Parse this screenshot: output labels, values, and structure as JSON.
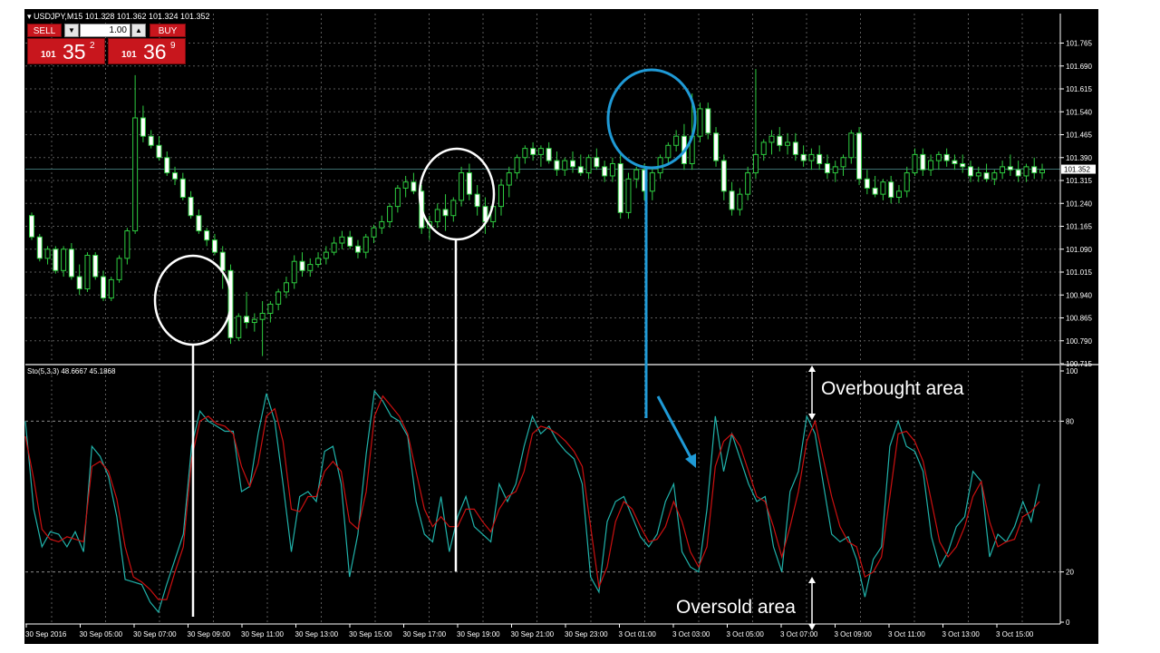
{
  "chart_data": [
    {
      "type": "candlestick",
      "title": "USDJPY,M15  101.328 101.362 101.324 101.352",
      "yticks": [
        "101.765",
        "101.690",
        "101.615",
        "101.540",
        "101.465",
        "101.390",
        "101.315",
        "101.240",
        "101.165",
        "101.090",
        "101.015",
        "100.940",
        "100.865",
        "100.790",
        "100.715"
      ],
      "ylim": [
        100.715,
        101.79
      ],
      "current_price": "101.352",
      "grid": true,
      "candles": [
        [
          101.2,
          101.21,
          101.12,
          101.13
        ],
        [
          101.13,
          101.14,
          101.05,
          101.06
        ],
        [
          101.06,
          101.1,
          101.04,
          101.09
        ],
        [
          101.09,
          101.1,
          101.01,
          101.02
        ],
        [
          101.02,
          101.1,
          101.0,
          101.09
        ],
        [
          101.09,
          101.11,
          100.99,
          101.0
        ],
        [
          101.0,
          101.04,
          100.94,
          100.96
        ],
        [
          100.96,
          101.08,
          100.95,
          101.07
        ],
        [
          101.07,
          101.08,
          100.99,
          101.0
        ],
        [
          101.0,
          101.02,
          100.92,
          100.93
        ],
        [
          100.93,
          101.0,
          100.92,
          100.99
        ],
        [
          100.99,
          101.07,
          100.98,
          101.06
        ],
        [
          101.06,
          101.16,
          101.04,
          101.15
        ],
        [
          101.15,
          101.66,
          101.14,
          101.52
        ],
        [
          101.52,
          101.56,
          101.44,
          101.46
        ],
        [
          101.46,
          101.48,
          101.42,
          101.43
        ],
        [
          101.43,
          101.46,
          101.38,
          101.39
        ],
        [
          101.39,
          101.41,
          101.33,
          101.34
        ],
        [
          101.34,
          101.36,
          101.3,
          101.32
        ],
        [
          101.32,
          101.34,
          101.25,
          101.26
        ],
        [
          101.26,
          101.28,
          101.19,
          101.2
        ],
        [
          101.2,
          101.22,
          101.14,
          101.15
        ],
        [
          101.15,
          101.16,
          101.1,
          101.12
        ],
        [
          101.12,
          101.14,
          101.07,
          101.08
        ],
        [
          101.08,
          101.1,
          100.96,
          101.02
        ],
        [
          101.02,
          101.04,
          100.78,
          100.8
        ],
        [
          100.8,
          100.88,
          100.79,
          100.87
        ],
        [
          100.87,
          100.95,
          100.83,
          100.85
        ],
        [
          100.85,
          100.88,
          100.82,
          100.86
        ],
        [
          100.86,
          100.92,
          100.74,
          100.88
        ],
        [
          100.88,
          100.92,
          100.85,
          100.91
        ],
        [
          100.91,
          100.96,
          100.89,
          100.95
        ],
        [
          100.95,
          101.0,
          100.93,
          100.98
        ],
        [
          100.98,
          101.07,
          100.96,
          101.05
        ],
        [
          101.05,
          101.08,
          101.0,
          101.02
        ],
        [
          101.02,
          101.06,
          101.0,
          101.04
        ],
        [
          101.04,
          101.08,
          101.03,
          101.06
        ],
        [
          101.06,
          101.1,
          101.04,
          101.08
        ],
        [
          101.08,
          101.13,
          101.07,
          101.11
        ],
        [
          101.11,
          101.15,
          101.09,
          101.13
        ],
        [
          101.13,
          101.15,
          101.09,
          101.1
        ],
        [
          101.1,
          101.12,
          101.06,
          101.08
        ],
        [
          101.08,
          101.14,
          101.06,
          101.13
        ],
        [
          101.13,
          101.17,
          101.11,
          101.16
        ],
        [
          101.16,
          101.2,
          101.14,
          101.18
        ],
        [
          101.18,
          101.24,
          101.16,
          101.23
        ],
        [
          101.23,
          101.3,
          101.21,
          101.29
        ],
        [
          101.29,
          101.33,
          101.26,
          101.31
        ],
        [
          101.31,
          101.34,
          101.27,
          101.28
        ],
        [
          101.28,
          101.3,
          101.14,
          101.16
        ],
        [
          101.16,
          101.2,
          101.12,
          101.18
        ],
        [
          101.18,
          101.24,
          101.16,
          101.22
        ],
        [
          101.22,
          101.27,
          101.15,
          101.2
        ],
        [
          101.2,
          101.26,
          101.18,
          101.25
        ],
        [
          101.25,
          101.36,
          101.23,
          101.34
        ],
        [
          101.34,
          101.37,
          101.25,
          101.27
        ],
        [
          101.27,
          101.3,
          101.2,
          101.23
        ],
        [
          101.23,
          101.26,
          101.14,
          101.18
        ],
        [
          101.18,
          101.24,
          101.16,
          101.23
        ],
        [
          101.23,
          101.32,
          101.2,
          101.3
        ],
        [
          101.3,
          101.36,
          101.26,
          101.34
        ],
        [
          101.34,
          101.4,
          101.32,
          101.39
        ],
        [
          101.39,
          101.43,
          101.37,
          101.42
        ],
        [
          101.42,
          101.44,
          101.38,
          101.4
        ],
        [
          101.4,
          101.43,
          101.36,
          101.42
        ],
        [
          101.42,
          101.44,
          101.37,
          101.38
        ],
        [
          101.38,
          101.41,
          101.33,
          101.35
        ],
        [
          101.35,
          101.39,
          101.33,
          101.38
        ],
        [
          101.38,
          101.41,
          101.34,
          101.36
        ],
        [
          101.36,
          101.4,
          101.33,
          101.34
        ],
        [
          101.34,
          101.4,
          101.32,
          101.39
        ],
        [
          101.39,
          101.42,
          101.35,
          101.36
        ],
        [
          101.36,
          101.38,
          101.31,
          101.33
        ],
        [
          101.33,
          101.39,
          101.31,
          101.37
        ],
        [
          101.37,
          101.4,
          101.19,
          101.21
        ],
        [
          101.21,
          101.34,
          101.19,
          101.32
        ],
        [
          101.32,
          101.36,
          101.29,
          101.35
        ],
        [
          101.35,
          101.37,
          101.25,
          101.28
        ],
        [
          101.28,
          101.36,
          101.25,
          101.34
        ],
        [
          101.34,
          101.4,
          101.32,
          101.39
        ],
        [
          101.39,
          101.44,
          101.37,
          101.43
        ],
        [
          101.43,
          101.48,
          101.41,
          101.46
        ],
        [
          101.46,
          101.5,
          101.35,
          101.37
        ],
        [
          101.37,
          101.6,
          101.35,
          101.46
        ],
        [
          101.46,
          101.57,
          101.44,
          101.55
        ],
        [
          101.55,
          101.57,
          101.45,
          101.47
        ],
        [
          101.47,
          101.49,
          101.36,
          101.38
        ],
        [
          101.38,
          101.4,
          101.25,
          101.28
        ],
        [
          101.28,
          101.31,
          101.2,
          101.22
        ],
        [
          101.22,
          101.29,
          101.2,
          101.27
        ],
        [
          101.27,
          101.36,
          101.25,
          101.34
        ],
        [
          101.34,
          101.68,
          101.32,
          101.4
        ],
        [
          101.4,
          101.45,
          101.38,
          101.44
        ],
        [
          101.44,
          101.48,
          101.4,
          101.46
        ],
        [
          101.46,
          101.49,
          101.41,
          101.43
        ],
        [
          101.43,
          101.47,
          101.4,
          101.44
        ],
        [
          101.44,
          101.47,
          101.38,
          101.4
        ],
        [
          101.4,
          101.43,
          101.36,
          101.38
        ],
        [
          101.38,
          101.42,
          101.35,
          101.4
        ],
        [
          101.4,
          101.43,
          101.35,
          101.37
        ],
        [
          101.37,
          101.4,
          101.32,
          101.34
        ],
        [
          101.34,
          101.38,
          101.31,
          101.36
        ],
        [
          101.36,
          101.4,
          101.33,
          101.39
        ],
        [
          101.39,
          101.48,
          101.37,
          101.47
        ],
        [
          101.47,
          101.49,
          101.3,
          101.32
        ],
        [
          101.32,
          101.35,
          101.27,
          101.29
        ],
        [
          101.29,
          101.33,
          101.26,
          101.27
        ],
        [
          101.27,
          101.32,
          101.25,
          101.31
        ],
        [
          101.31,
          101.33,
          101.24,
          101.26
        ],
        [
          101.26,
          101.3,
          101.24,
          101.28
        ],
        [
          101.28,
          101.36,
          101.26,
          101.34
        ],
        [
          101.34,
          101.42,
          101.33,
          101.4
        ],
        [
          101.4,
          101.42,
          101.33,
          101.35
        ],
        [
          101.35,
          101.4,
          101.33,
          101.38
        ],
        [
          101.38,
          101.41,
          101.35,
          101.4
        ],
        [
          101.4,
          101.42,
          101.36,
          101.38
        ],
        [
          101.38,
          101.4,
          101.35,
          101.37
        ],
        [
          101.37,
          101.4,
          101.34,
          101.36
        ],
        [
          101.36,
          101.38,
          101.31,
          101.33
        ],
        [
          101.33,
          101.36,
          101.31,
          101.34
        ],
        [
          101.34,
          101.37,
          101.31,
          101.32
        ],
        [
          101.32,
          101.35,
          101.3,
          101.34
        ],
        [
          101.34,
          101.38,
          101.32,
          101.36
        ],
        [
          101.36,
          101.4,
          101.33,
          101.35
        ],
        [
          101.35,
          101.38,
          101.31,
          101.33
        ],
        [
          101.33,
          101.37,
          101.31,
          101.36
        ],
        [
          101.36,
          101.39,
          101.32,
          101.34
        ],
        [
          101.34,
          101.37,
          101.32,
          101.35
        ]
      ]
    },
    {
      "type": "line",
      "title": "Sto(5,3,3) 48.6667 45.1868",
      "yticks": [
        "100",
        "80",
        "20",
        "0"
      ],
      "ylim": [
        0,
        100
      ],
      "xlabels": [
        "30 Sep 2016",
        "30 Sep 05:00",
        "30 Sep 07:00",
        "30 Sep 09:00",
        "30 Sep 11:00",
        "30 Sep 13:00",
        "30 Sep 15:00",
        "30 Sep 17:00",
        "30 Sep 19:00",
        "30 Sep 21:00",
        "30 Sep 23:00",
        "3 Oct 01:00",
        "3 Oct 03:00",
        "3 Oct 05:00",
        "3 Oct 07:00",
        "3 Oct 09:00",
        "3 Oct 11:00",
        "3 Oct 13:00",
        "3 Oct 15:00"
      ],
      "series": [
        {
          "color": "#20b2aa",
          "values": [
            80,
            45,
            30,
            36,
            35,
            30,
            36,
            28,
            70,
            66,
            58,
            42,
            17,
            16,
            15,
            8,
            4,
            15,
            25,
            35,
            70,
            84,
            80,
            78,
            76,
            76,
            52,
            54,
            75,
            91,
            80,
            55,
            28,
            50,
            52,
            48,
            68,
            70,
            55,
            18,
            35,
            67,
            92,
            88,
            82,
            80,
            74,
            48,
            35,
            32,
            50,
            28,
            42,
            50,
            38,
            35,
            32,
            55,
            48,
            55,
            70,
            82,
            75,
            78,
            72,
            68,
            65,
            55,
            18,
            12,
            40,
            48,
            50,
            42,
            34,
            30,
            35,
            48,
            55,
            28,
            22,
            20,
            45,
            82,
            60,
            75,
            65,
            55,
            48,
            50,
            30,
            20,
            52,
            60,
            82,
            75,
            55,
            35,
            32,
            34,
            25,
            10,
            25,
            30,
            70,
            80,
            70,
            68,
            60,
            34,
            22,
            28,
            38,
            42,
            60,
            56,
            26,
            35,
            32,
            38,
            48,
            40,
            55
          ]
        },
        {
          "color": "#cc1010",
          "values": [
            74,
            57,
            37,
            33,
            32,
            34,
            33,
            32,
            62,
            64,
            60,
            49,
            30,
            18,
            16,
            13,
            9,
            9,
            20,
            30,
            65,
            80,
            82,
            79,
            78,
            75,
            62,
            54,
            63,
            82,
            85,
            72,
            45,
            44,
            50,
            50,
            60,
            64,
            60,
            40,
            37,
            52,
            82,
            90,
            86,
            82,
            75,
            60,
            45,
            38,
            42,
            38,
            38,
            45,
            45,
            40,
            36,
            45,
            50,
            52,
            60,
            75,
            78,
            77,
            75,
            72,
            68,
            62,
            38,
            14,
            22,
            40,
            48,
            45,
            38,
            32,
            33,
            38,
            48,
            40,
            28,
            22,
            30,
            62,
            72,
            75,
            70,
            60,
            50,
            48,
            38,
            26,
            38,
            52,
            72,
            80,
            65,
            50,
            38,
            32,
            30,
            18,
            20,
            26,
            50,
            75,
            76,
            72,
            64,
            48,
            32,
            26,
            30,
            38,
            50,
            56,
            40,
            30,
            32,
            33,
            42,
            44,
            48
          ]
        }
      ]
    }
  ],
  "trade_panel": {
    "sell_label": "SELL",
    "buy_label": "BUY",
    "lot_value": "1.00",
    "down_arrow": "▼",
    "up_arrow": "▲",
    "sell_prefix": "101",
    "sell_big": "35",
    "sell_sup": "2",
    "buy_prefix": "101",
    "buy_big": "36",
    "buy_sup": "9"
  },
  "annotations": {
    "overbought": "Overbought area",
    "oversold": "Oversold area"
  }
}
